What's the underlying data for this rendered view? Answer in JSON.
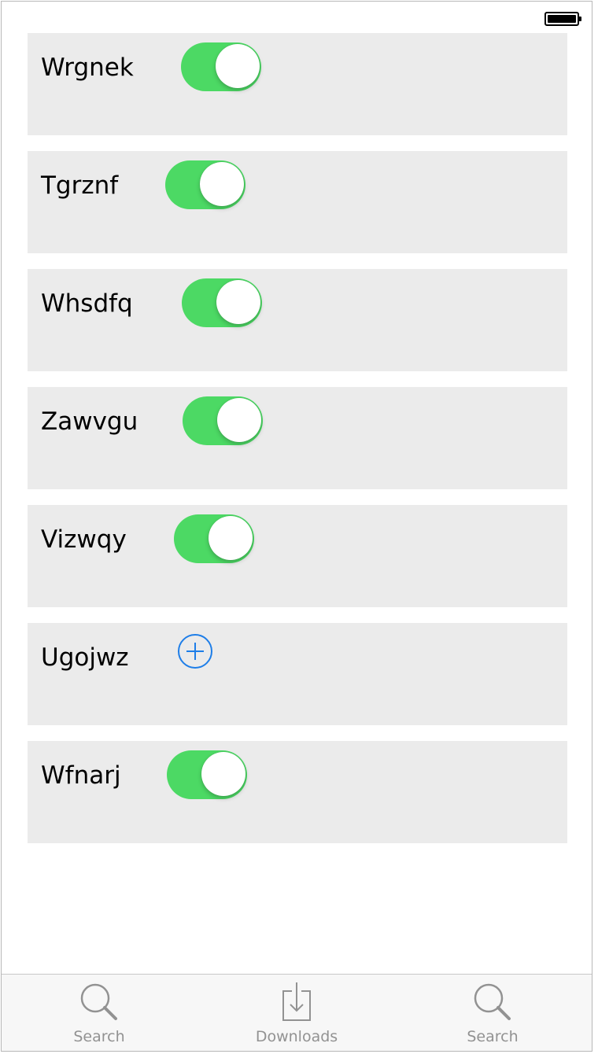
{
  "status_bar": {
    "battery_icon": "battery-full-icon"
  },
  "rows": [
    {
      "label": "Wrgnek",
      "control": "toggle",
      "on": true
    },
    {
      "label": "Tgrznf",
      "control": "toggle",
      "on": true
    },
    {
      "label": "Whsdfq",
      "control": "toggle",
      "on": true
    },
    {
      "label": "Zawvgu",
      "control": "toggle",
      "on": true
    },
    {
      "label": "Vizwqy",
      "control": "toggle",
      "on": true
    },
    {
      "label": "Ugojwz",
      "control": "add-button",
      "icon": "plus-circle-icon"
    },
    {
      "label": "Wfnarj",
      "control": "toggle",
      "on": true
    }
  ],
  "tabbar": {
    "tabs": [
      {
        "label": "Search",
        "icon": "search-icon"
      },
      {
        "label": "Downloads",
        "icon": "download-icon"
      },
      {
        "label": "Search",
        "icon": "search-icon"
      }
    ]
  },
  "colors": {
    "toggle_on": "#4cd964",
    "accent_blue": "#1e7ee8",
    "row_background": "#ebebeb",
    "tab_inactive": "#929292"
  }
}
